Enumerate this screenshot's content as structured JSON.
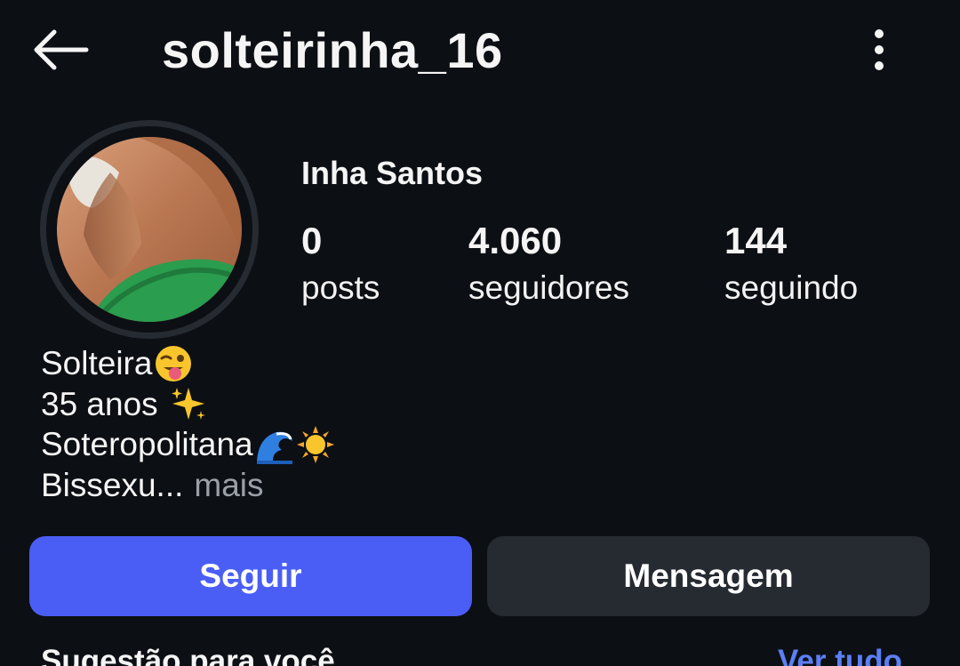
{
  "header": {
    "username": "solteirinha_16",
    "back_icon": "arrow-left-icon",
    "menu_icon": "more-vertical-icon"
  },
  "profile": {
    "display_name": "Inha Santos",
    "avatar": "profile-photo"
  },
  "stats": {
    "posts": {
      "count": "0",
      "label": "posts"
    },
    "followers": {
      "count": "4.060",
      "label": "seguidores"
    },
    "following": {
      "count": "144",
      "label": "seguindo"
    }
  },
  "bio": {
    "line1": "Solteira",
    "line1_emoji": "winking-face-tongue-emoji",
    "line2": "35 anos ",
    "line2_emoji": "sparkles-emoji",
    "line3": "Soteropolitana",
    "line3_emoji": [
      "wave-emoji",
      "sun-emoji"
    ],
    "line4": "Bissexu...",
    "more": "mais"
  },
  "actions": {
    "follow": "Seguir",
    "message": "Mensagem"
  },
  "suggestions": {
    "title": "Sugestão para você",
    "see_all": "Ver tudo"
  },
  "colors": {
    "background": "#0c0f14",
    "follow_button": "#4a5ef5",
    "message_button": "#262a31",
    "link": "#5c7ff5",
    "muted_text": "#9aa0a8"
  }
}
